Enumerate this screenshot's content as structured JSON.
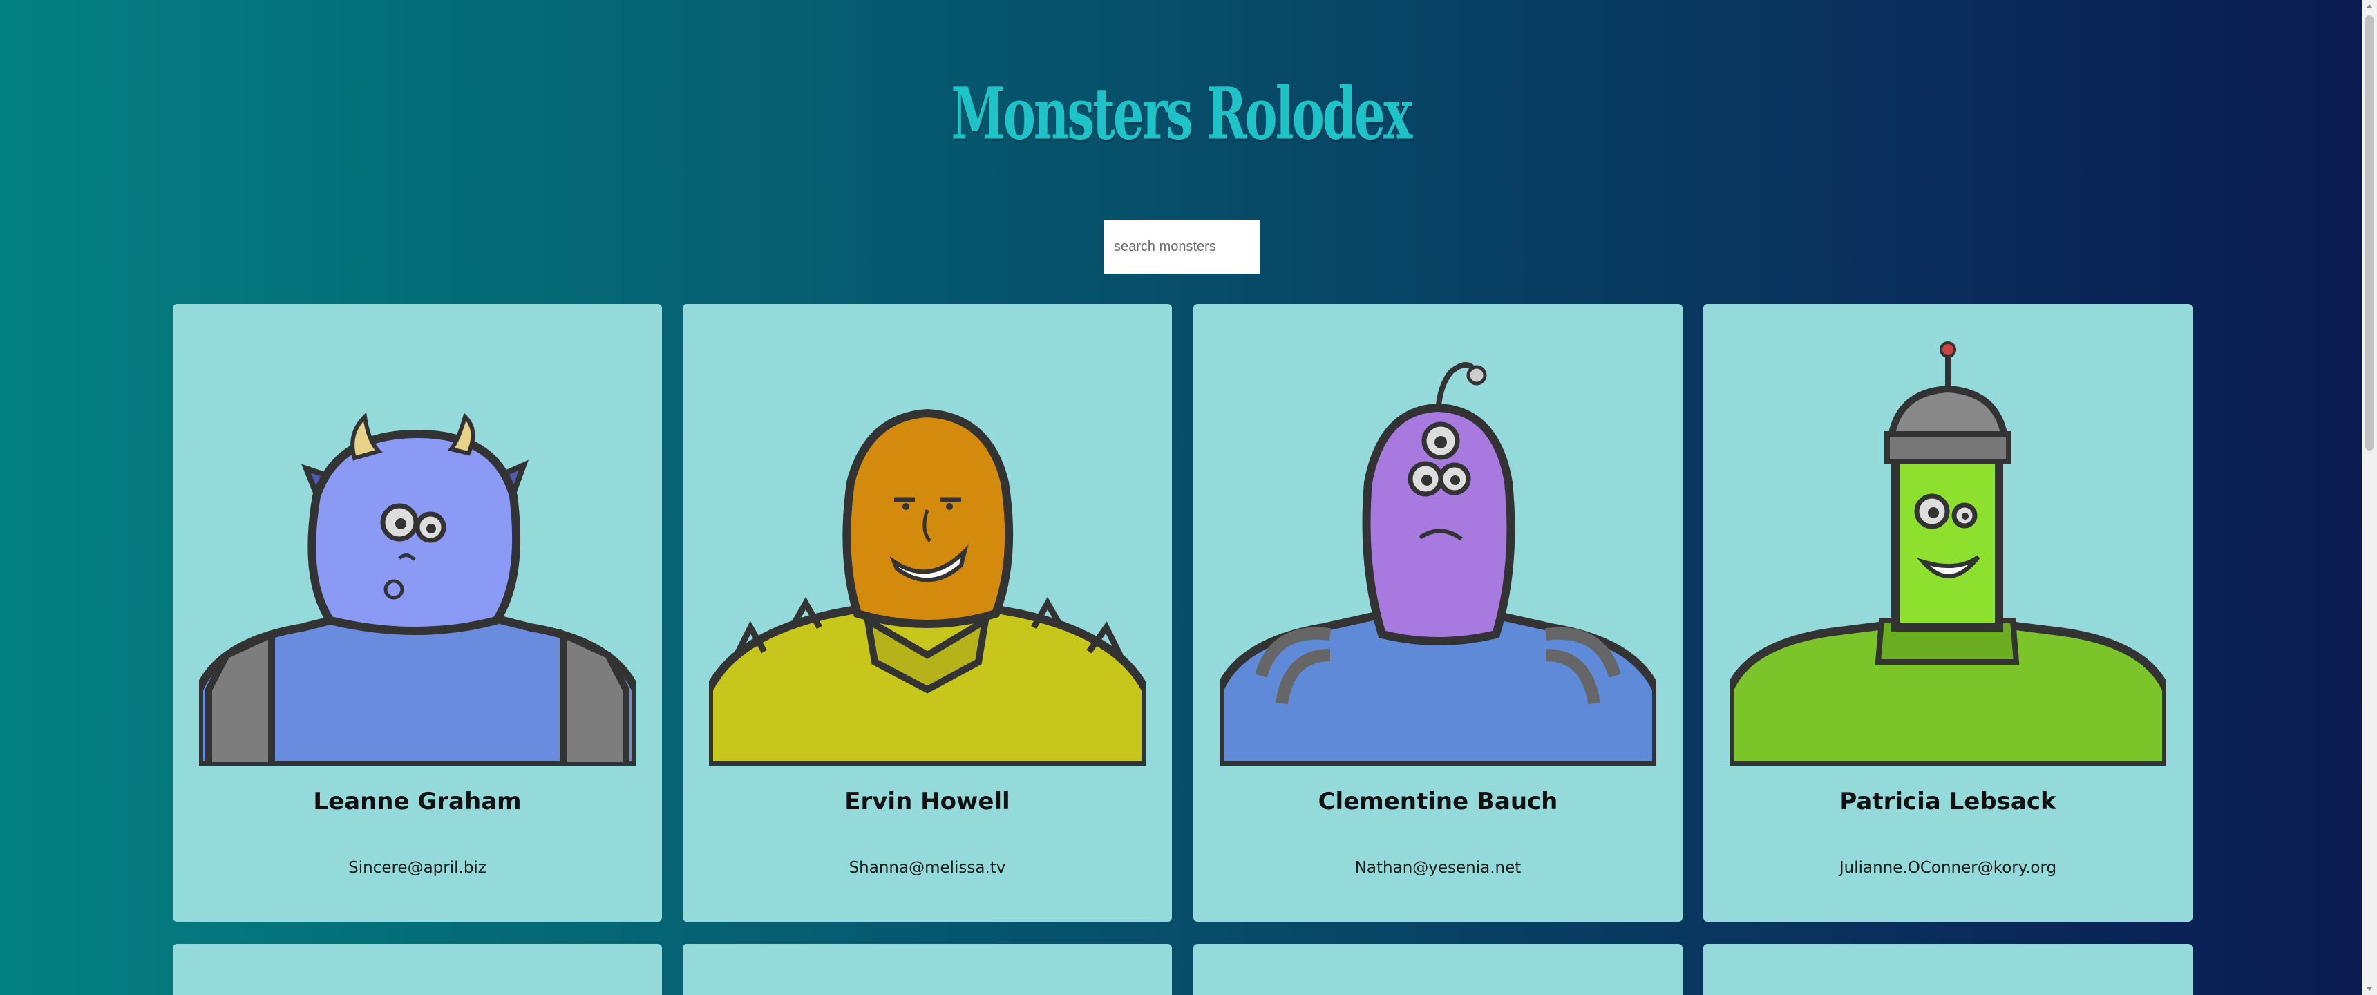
{
  "header": {
    "title": "Monsters Rolodex"
  },
  "search": {
    "placeholder": "search monsters",
    "value": ""
  },
  "colors": {
    "background_left": "#038080",
    "background_right": "#0b1a52",
    "title": "#1ec3c8",
    "card": "#95dada"
  },
  "monsters": [
    {
      "name": "Leanne Graham",
      "email": "Sincere@april.biz",
      "avatar": "blue-horned-monster-icon"
    },
    {
      "name": "Ervin Howell",
      "email": "Shanna@melissa.tv",
      "avatar": "orange-hooded-monster-icon"
    },
    {
      "name": "Clementine Bauch",
      "email": "Nathan@yesenia.net",
      "avatar": "purple-cyclops-monster-icon"
    },
    {
      "name": "Patricia Lebsack",
      "email": "Julianne.OConner@kory.org",
      "avatar": "green-robot-monster-icon"
    }
  ]
}
